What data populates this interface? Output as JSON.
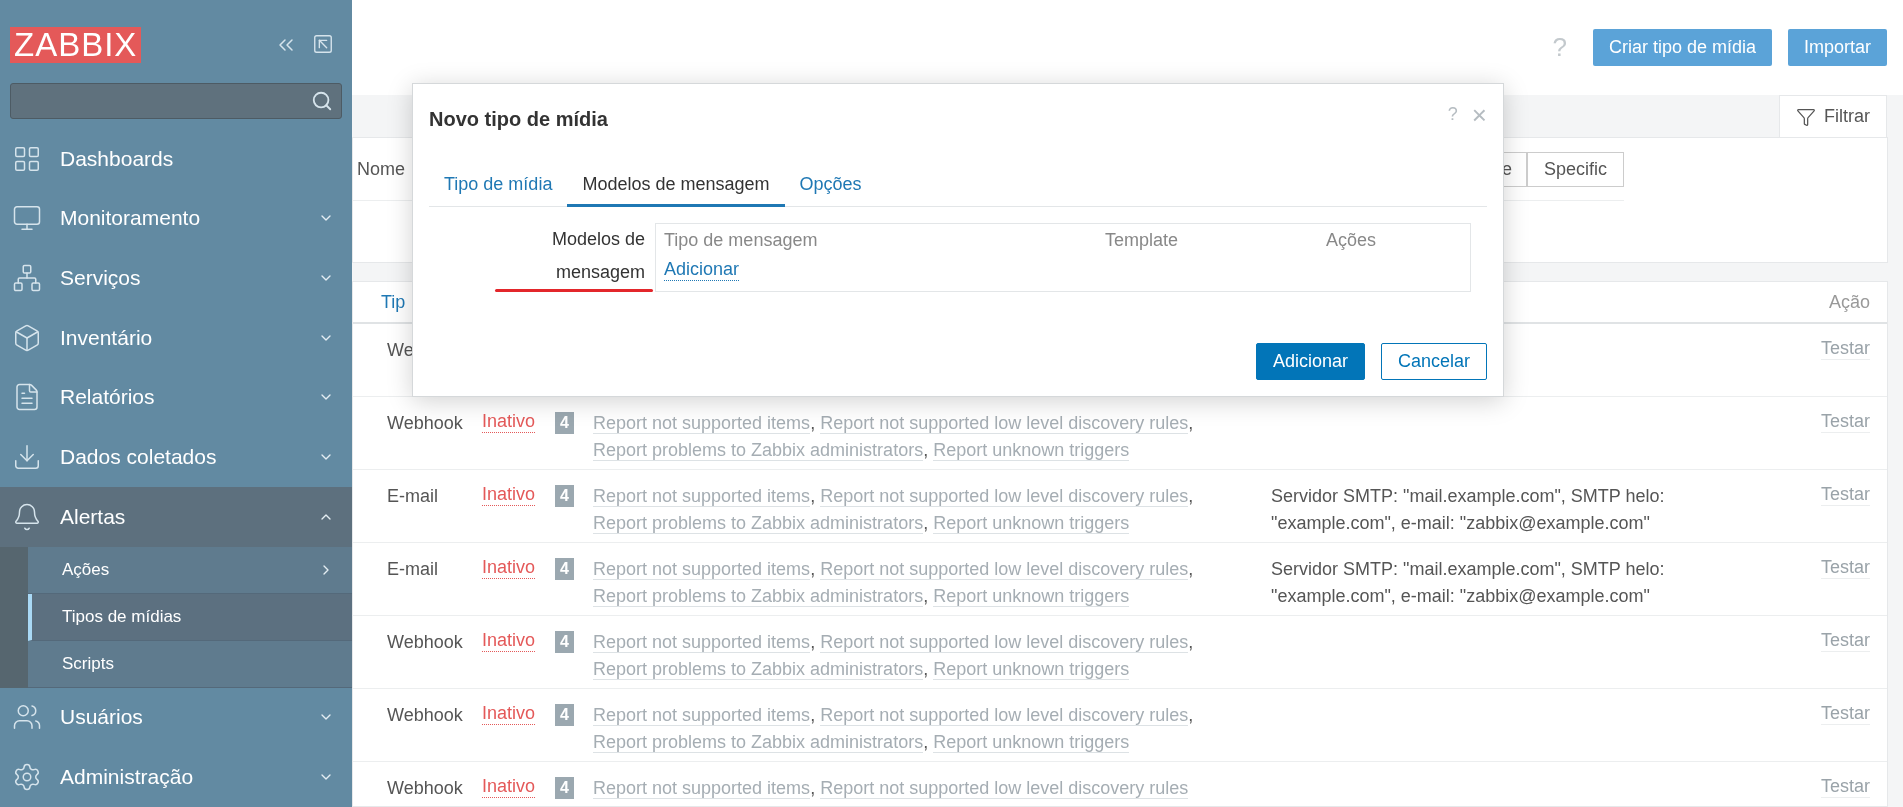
{
  "sidebar": {
    "logo": "ZABBIX",
    "items": [
      {
        "label": "Dashboards",
        "kind": "link"
      },
      {
        "label": "Monitoramento",
        "kind": "menu",
        "expanded": false
      },
      {
        "label": "Serviços",
        "kind": "menu",
        "expanded": false
      },
      {
        "label": "Inventário",
        "kind": "menu",
        "expanded": false
      },
      {
        "label": "Relatórios",
        "kind": "menu",
        "expanded": false
      },
      {
        "label": "Dados coletados",
        "kind": "menu",
        "expanded": false
      },
      {
        "label": "Alertas",
        "kind": "menu",
        "expanded": true,
        "children": [
          {
            "label": "Ações",
            "kind": "menu",
            "selected": false
          },
          {
            "label": "Tipos de mídias",
            "kind": "link",
            "selected": true
          },
          {
            "label": "Scripts",
            "kind": "link",
            "selected": false
          }
        ]
      },
      {
        "label": "Usuários",
        "kind": "menu",
        "expanded": false
      },
      {
        "label": "Administração",
        "kind": "menu",
        "expanded": false
      }
    ]
  },
  "header": {
    "help": "?",
    "buttons": [
      "Criar tipo de mídia",
      "Importar"
    ]
  },
  "filter": {
    "tab": "Filtrar",
    "name_label": "Nome",
    "segments": [
      "e",
      "Specific"
    ]
  },
  "table": {
    "columns": [
      "Tip",
      "Ação"
    ],
    "separator": ",",
    "rows": [
      {
        "type": "We",
        "status": "",
        "count": "",
        "actions": [],
        "details": "",
        "test": "Testar",
        "test_disabled": true
      },
      {
        "type": "Webhook",
        "status": "Inativo",
        "count": "4",
        "actions": [
          "Report not supported items",
          "Report not supported low level discovery rules",
          "Report problems to Zabbix administrators",
          "Report unknown triggers"
        ],
        "details": "",
        "test": "Testar",
        "test_disabled": true
      },
      {
        "type": "E-mail",
        "status": "Inativo",
        "count": "4",
        "actions": [
          "Report not supported items",
          "Report not supported low level discovery rules",
          "Report problems to Zabbix administrators",
          "Report unknown triggers"
        ],
        "details": "Servidor SMTP: \"mail.example.com\", SMTP helo: \"example.com\", e-mail: \"zabbix@example.com\"",
        "test": "Testar",
        "test_disabled": true
      },
      {
        "type": "E-mail",
        "status": "Inativo",
        "count": "4",
        "actions": [
          "Report not supported items",
          "Report not supported low level discovery rules",
          "Report problems to Zabbix administrators",
          "Report unknown triggers"
        ],
        "details": "Servidor SMTP: \"mail.example.com\", SMTP helo: \"example.com\", e-mail: \"zabbix@example.com\"",
        "test": "Testar",
        "test_disabled": true
      },
      {
        "type": "Webhook",
        "status": "Inativo",
        "count": "4",
        "actions": [
          "Report not supported items",
          "Report not supported low level discovery rules",
          "Report problems to Zabbix administrators",
          "Report unknown triggers"
        ],
        "details": "",
        "test": "Testar",
        "test_disabled": true
      },
      {
        "type": "Webhook",
        "status": "Inativo",
        "count": "4",
        "actions": [
          "Report not supported items",
          "Report not supported low level discovery rules",
          "Report problems to Zabbix administrators",
          "Report unknown triggers"
        ],
        "details": "",
        "test": "Testar",
        "test_disabled": true
      },
      {
        "type": "Webhook",
        "status": "Inativo",
        "count": "4",
        "actions": [
          "Report not supported items",
          "Report not supported low level discovery rules"
        ],
        "details": "",
        "test": "Testar",
        "test_disabled": true
      }
    ]
  },
  "modal": {
    "title": "Novo tipo de mídia",
    "help": "?",
    "close": "×",
    "tabs": [
      {
        "label": "Tipo de mídia",
        "selected": false
      },
      {
        "label": "Modelos de mensagem",
        "selected": true
      },
      {
        "label": "Opções",
        "selected": false
      }
    ],
    "field_label": "Modelos de mensagem",
    "columns": [
      "Tipo de mensagem",
      "Template",
      "Ações"
    ],
    "add_link": "Adicionar",
    "buttons": [
      {
        "label": "Adicionar",
        "kind": "primary"
      },
      {
        "label": "Cancelar",
        "kind": "secondary"
      }
    ]
  }
}
